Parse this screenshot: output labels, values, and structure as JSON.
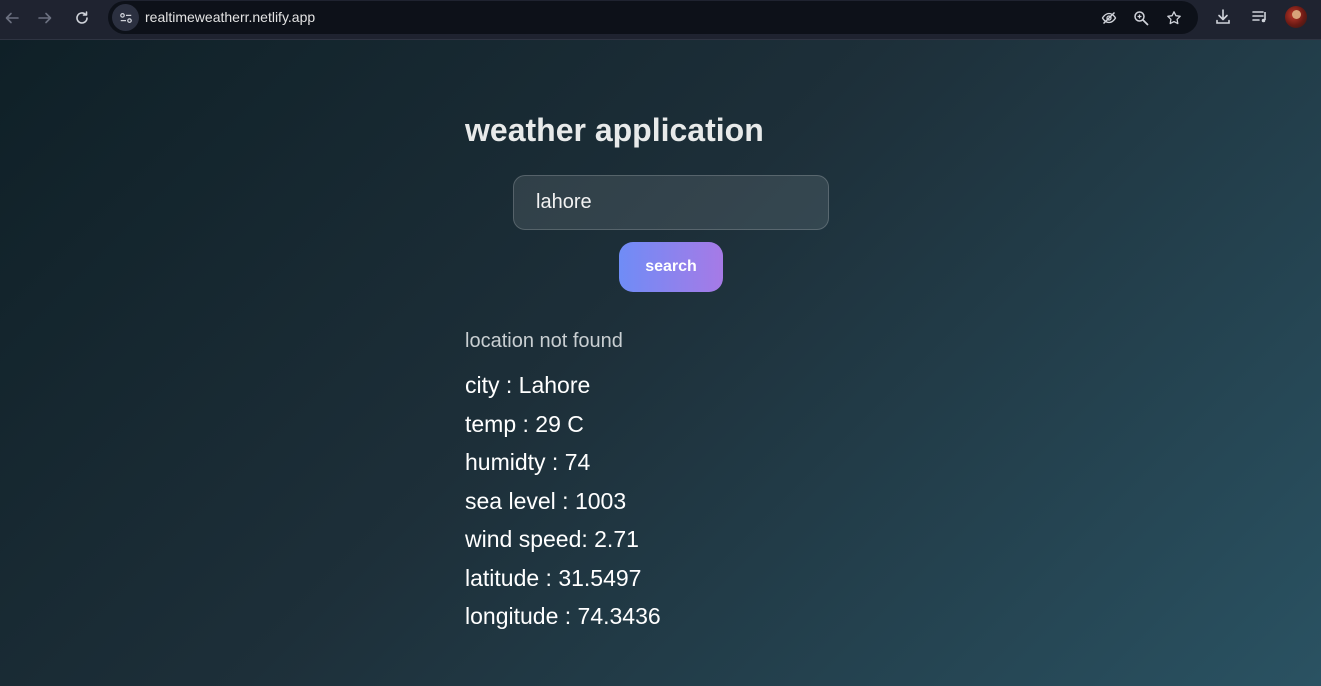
{
  "browser": {
    "url": "realtimeweatherr.netlify.app",
    "icons": {
      "back": "back-arrow-icon",
      "forward": "forward-arrow-icon",
      "reload": "reload-icon",
      "site_info": "site-settings-icon",
      "tracking": "eye-off-icon",
      "zoom": "zoom-icon",
      "bookmark": "star-icon",
      "download": "download-icon",
      "media": "playlist-icon",
      "profile": "avatar"
    }
  },
  "app": {
    "title": "weather application",
    "search": {
      "value": "lahore",
      "button_label": "search"
    },
    "status": "location not found",
    "details": [
      "city : Lahore",
      "temp : 29 C",
      "humidty : 74",
      "sea level : 1003",
      "wind speed: 2.71",
      "latitude : 31.5497",
      "longitude : 74.3436"
    ]
  },
  "colors": {
    "background_start": "#0f2027",
    "background_mid": "#1d2f39",
    "background_end": "#2a5262",
    "button_start": "#6f8cf6",
    "button_end": "#a67ae6",
    "chrome": "#1f2330"
  }
}
